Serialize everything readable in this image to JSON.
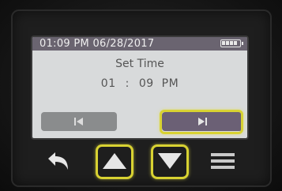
{
  "status_bar": {
    "datetime": "01:09 PM 06/28/2017",
    "battery_level": 1.0
  },
  "screen": {
    "title": "Set Time",
    "hour": "01",
    "separator": ":",
    "minute": "09",
    "ampm": "PM"
  },
  "soft_buttons": {
    "prev": {
      "icon": "skip-previous-icon",
      "color": "#8a8c8d"
    },
    "next": {
      "icon": "skip-next-icon",
      "color": "#6b6075",
      "highlighted": true
    }
  },
  "hardware_buttons": [
    {
      "icon": "back-arrow-icon",
      "highlighted": false
    },
    {
      "icon": "up-triangle-icon",
      "highlighted": true
    },
    {
      "icon": "down-triangle-icon",
      "highlighted": true
    },
    {
      "icon": "menu-icon",
      "highlighted": false
    }
  ],
  "colors": {
    "screen_background": "#d8dadb",
    "status_bar": "#6a6470",
    "highlight": "#d8d232",
    "icon_white": "#e6e6e6"
  }
}
